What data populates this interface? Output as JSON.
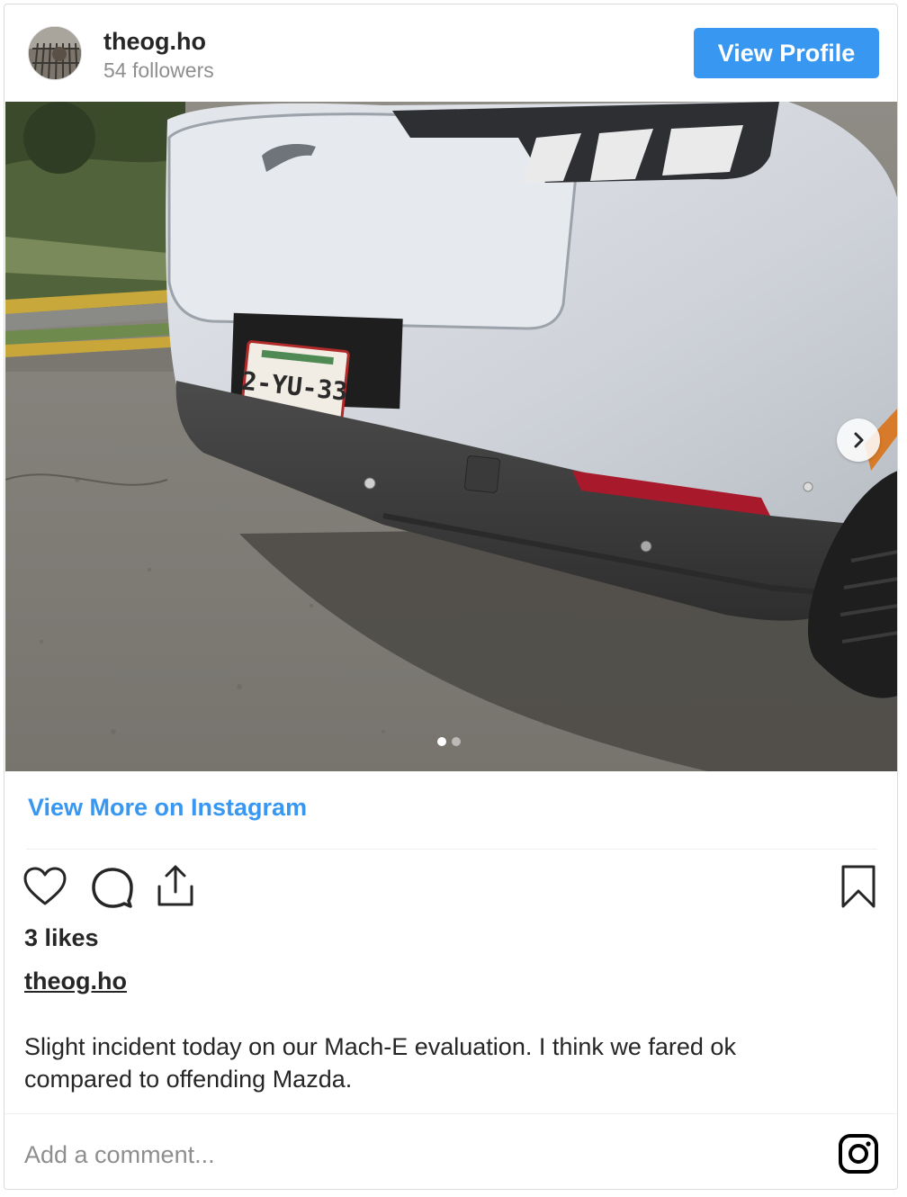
{
  "header": {
    "username": "theog.ho",
    "followers": "54 followers",
    "view_profile_label": "View Profile"
  },
  "photo": {
    "plate_text": "2-YU-33",
    "carousel_total": 2,
    "carousel_active": 1
  },
  "view_more_label": "View More on Instagram",
  "actions": {
    "icons": [
      "heart-icon",
      "comment-icon",
      "share-icon",
      "bookmark-icon"
    ]
  },
  "likes": "3 likes",
  "caption": {
    "username": "theog.ho",
    "text": "Slight incident today on our Mach-E evaluation. I think we fared ok compared to offending Mazda."
  },
  "comment": {
    "placeholder": "Add a comment..."
  },
  "colors": {
    "accent": "#3897f0",
    "text": "#262626",
    "muted": "#8e8e8e"
  }
}
